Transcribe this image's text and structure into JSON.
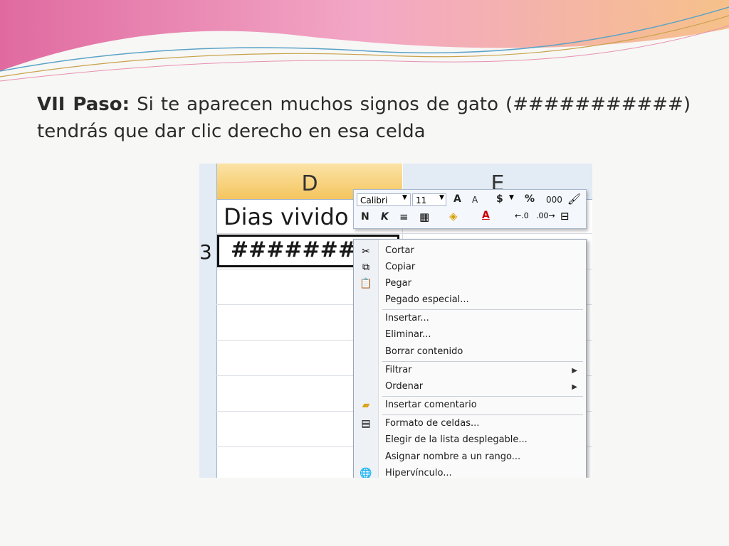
{
  "slide": {
    "step_label": "VII Paso:",
    "step_text": " Si te aparecen muchos signos de gato (###########) tendrás que dar clic derecho en esa celda"
  },
  "spreadsheet": {
    "columns": [
      "D",
      "E"
    ],
    "row_number": "3",
    "header_cell": "Dias vivido",
    "value_cell": "#########"
  },
  "mini_toolbar": {
    "font": "Calibri",
    "size": "11",
    "grow_font": "A",
    "shrink_font": "A",
    "currency": "$",
    "percent": "%",
    "thousands": "000",
    "bold": "N",
    "italic": "K",
    "font_color": "A"
  },
  "context_menu": {
    "cut": "Cortar",
    "copy": "Copiar",
    "paste": "Pegar",
    "paste_special": "Pegado especial...",
    "insert": "Insertar...",
    "delete": "Eliminar...",
    "clear": "Borrar contenido",
    "filter": "Filtrar",
    "sort": "Ordenar",
    "insert_comment": "Insertar comentario",
    "format_cells": "Formato de celdas...",
    "pick_list": "Elegir de la lista desplegable...",
    "name_range": "Asignar nombre a un rango...",
    "hyperlink": "Hipervínculo..."
  },
  "colors": {
    "banner_pink": "#f08fb7",
    "banner_orange": "#f7c08a",
    "selected_header": "#f5c55f"
  }
}
